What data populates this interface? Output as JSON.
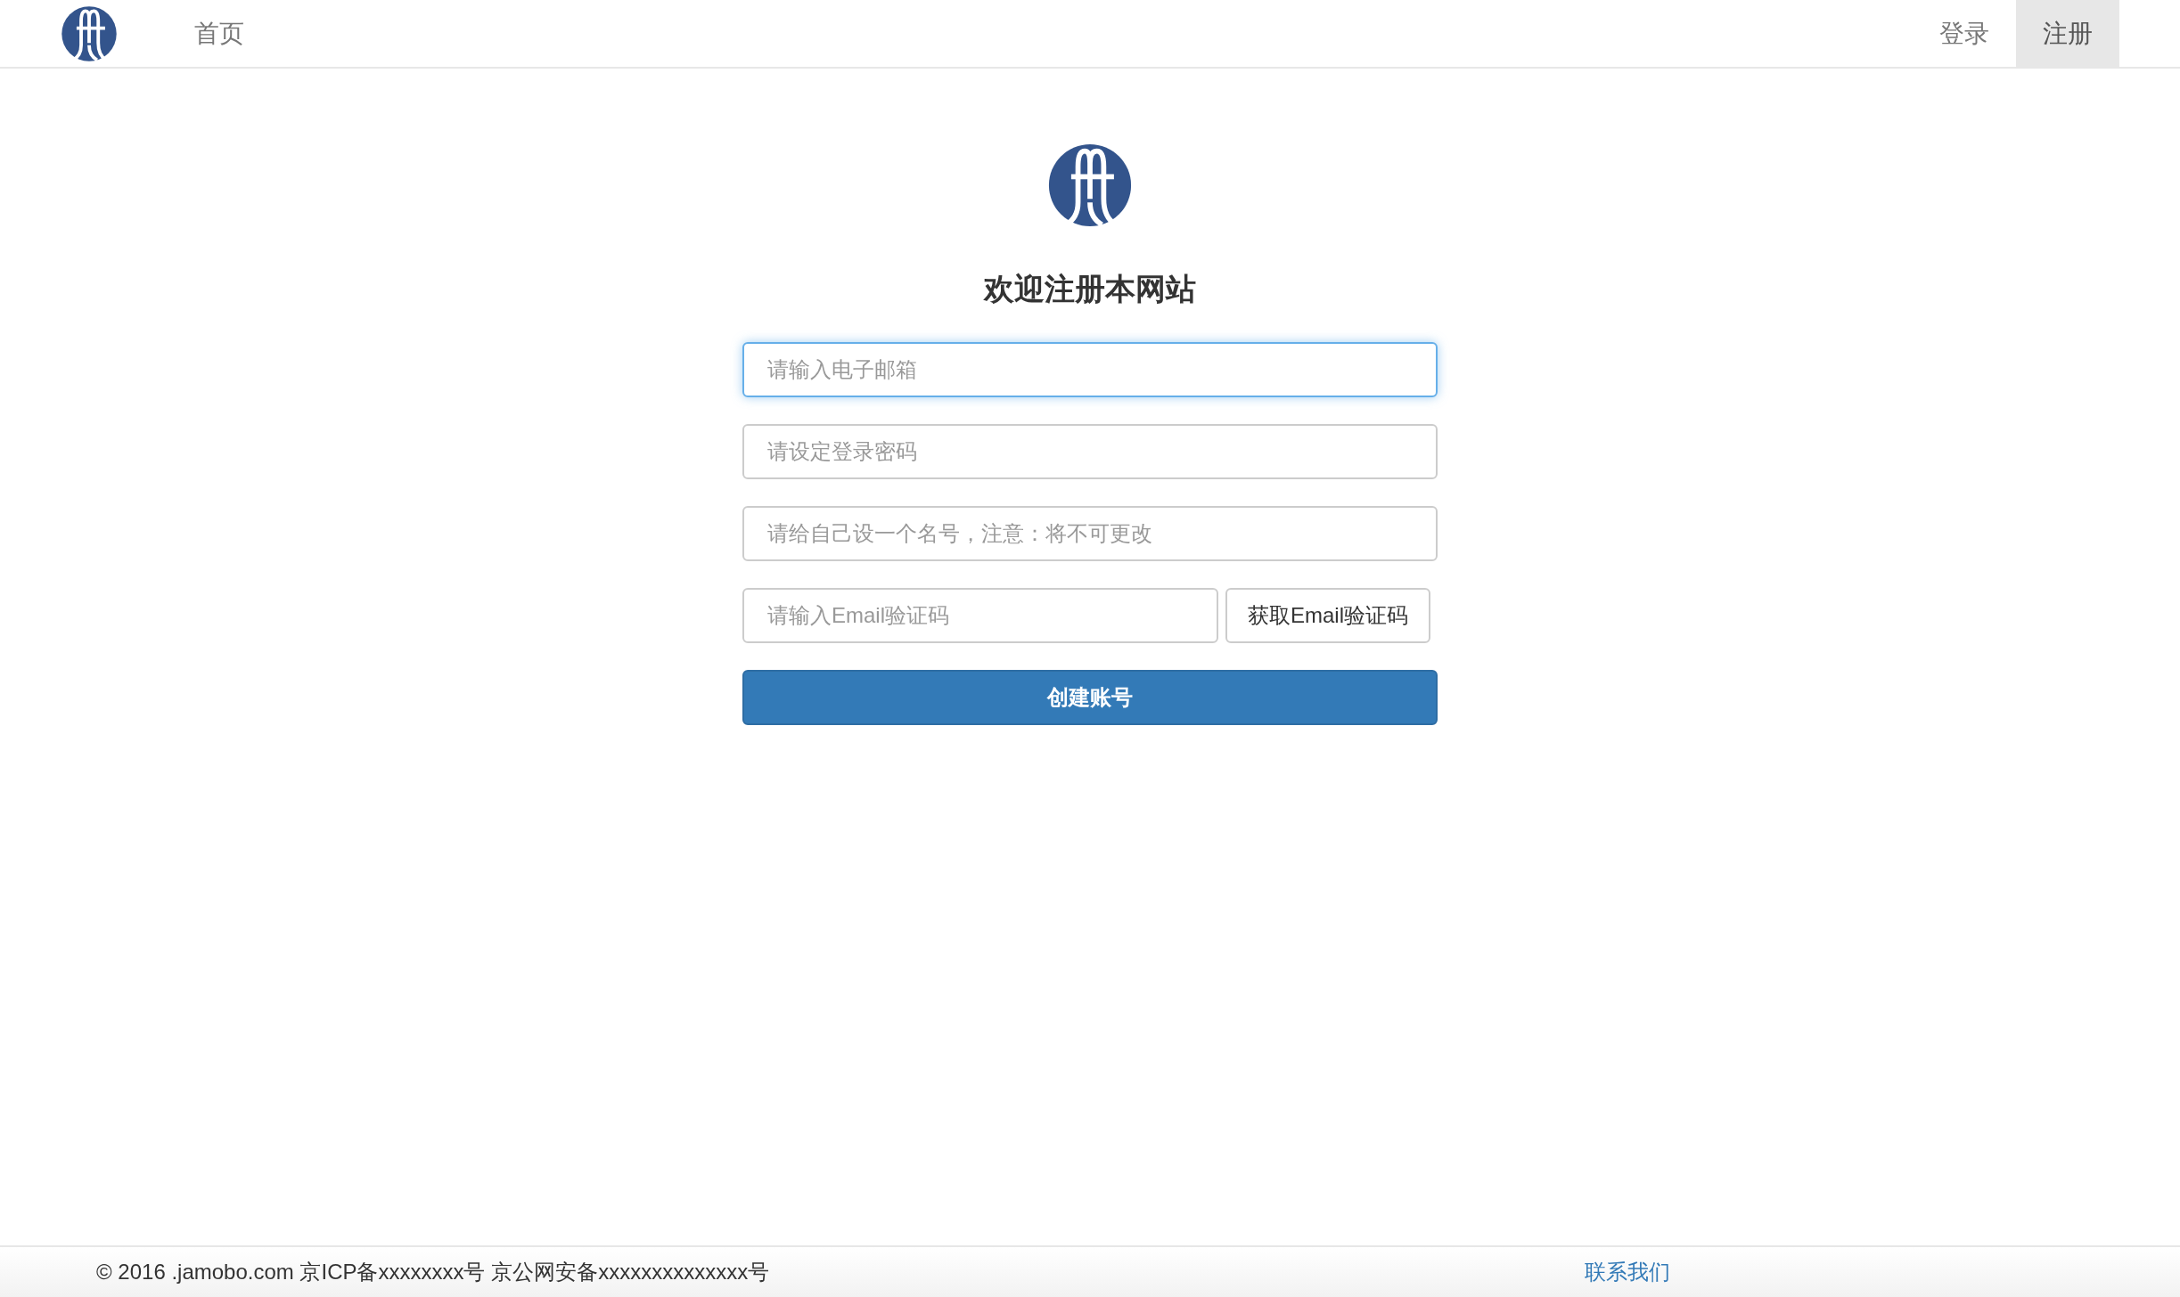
{
  "navbar": {
    "left_links": [
      {
        "label": "首页",
        "selected": false
      }
    ],
    "right_links": [
      {
        "label": "登录",
        "selected": false
      },
      {
        "label": "注册",
        "selected": true
      }
    ]
  },
  "form": {
    "title": "欢迎注册本网站",
    "fields": [
      {
        "kind": "input",
        "placeholder": "请输入电子邮箱",
        "focused": true
      },
      {
        "kind": "input",
        "placeholder": "请设定登录密码",
        "focused": false
      },
      {
        "kind": "input",
        "placeholder": "请给自己设一个名号，注意：将不可更改",
        "focused": false
      },
      {
        "kind": "input_with_button",
        "placeholder": "请输入Email验证码",
        "focused": false,
        "button": "获取Email验证码"
      }
    ],
    "submit": "创建账号"
  },
  "footer": {
    "copyright": "© 2016 .jamobo.com 京ICP备xxxxxxxx号 京公网安备xxxxxxxxxxxxxx号",
    "contact_link": "联系我们"
  }
}
